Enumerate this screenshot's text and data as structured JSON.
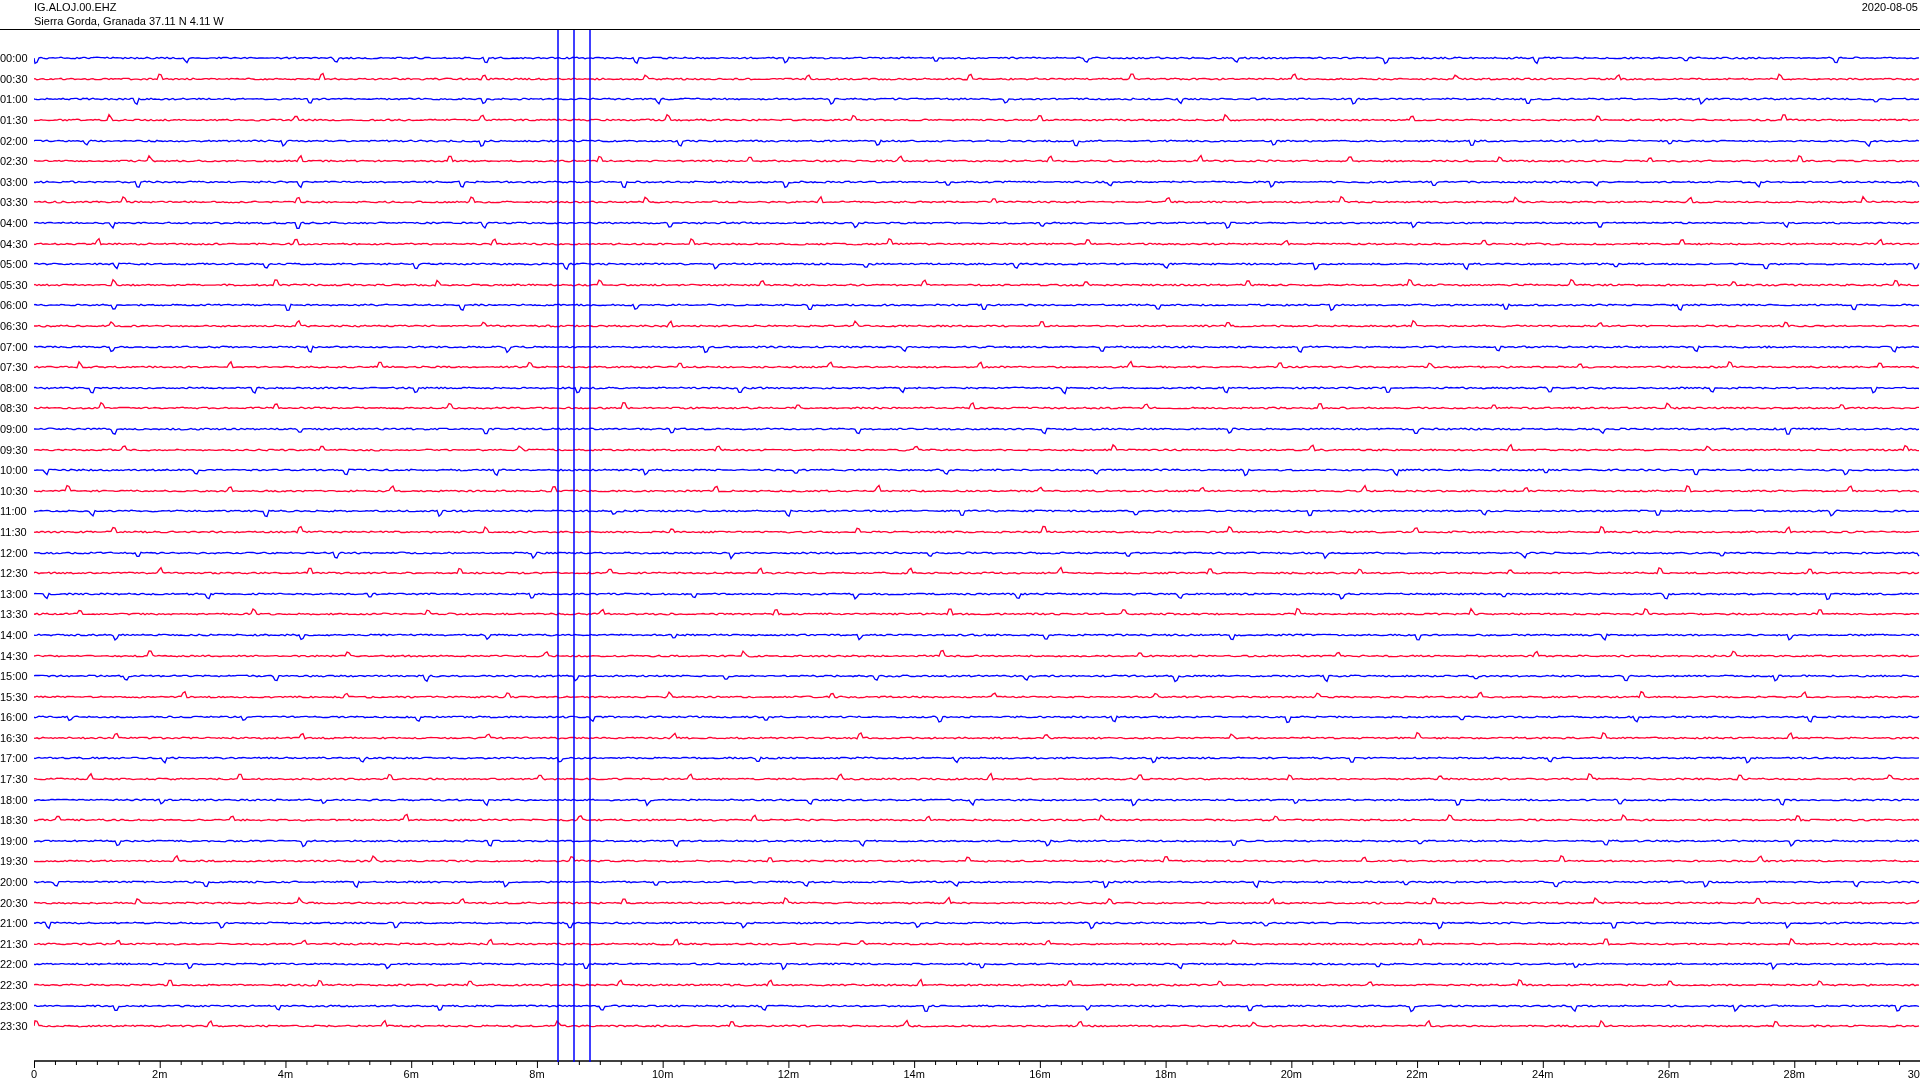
{
  "header": {
    "station": "IG.ALOJ.00.EHZ",
    "location": "Sierra Gorda, Granada  37.11 N 4.11 W",
    "date": "2020-08-05"
  },
  "rows": [
    {
      "time": "00:00",
      "color": "#0000ff"
    },
    {
      "time": "00:30",
      "color": "#ff0033"
    },
    {
      "time": "01:00",
      "color": "#0000ff"
    },
    {
      "time": "01:30",
      "color": "#ff0033"
    },
    {
      "time": "02:00",
      "color": "#0000ff"
    },
    {
      "time": "02:30",
      "color": "#ff0033"
    },
    {
      "time": "03:00",
      "color": "#0000ff"
    },
    {
      "time": "03:30",
      "color": "#ff0033"
    },
    {
      "time": "04:00",
      "color": "#0000ff"
    },
    {
      "time": "04:30",
      "color": "#ff0033"
    },
    {
      "time": "05:00",
      "color": "#0000ff"
    },
    {
      "time": "05:30",
      "color": "#ff0033"
    },
    {
      "time": "06:00",
      "color": "#0000ff"
    },
    {
      "time": "06:30",
      "color": "#ff0033"
    },
    {
      "time": "07:00",
      "color": "#0000ff"
    },
    {
      "time": "07:30",
      "color": "#ff0033"
    },
    {
      "time": "08:00",
      "color": "#0000ff"
    },
    {
      "time": "08:30",
      "color": "#ff0033"
    },
    {
      "time": "09:00",
      "color": "#0000ff"
    },
    {
      "time": "09:30",
      "color": "#ff0033"
    },
    {
      "time": "10:00",
      "color": "#0000ff"
    },
    {
      "time": "10:30",
      "color": "#ff0033"
    },
    {
      "time": "11:00",
      "color": "#0000ff"
    },
    {
      "time": "11:30",
      "color": "#ff0033"
    },
    {
      "time": "12:00",
      "color": "#0000ff"
    },
    {
      "time": "12:30",
      "color": "#ff0033"
    },
    {
      "time": "13:00",
      "color": "#0000ff"
    },
    {
      "time": "13:30",
      "color": "#ff0033"
    },
    {
      "time": "14:00",
      "color": "#0000ff"
    },
    {
      "time": "14:30",
      "color": "#ff0033"
    },
    {
      "time": "15:00",
      "color": "#0000ff"
    },
    {
      "time": "15:30",
      "color": "#ff0033"
    },
    {
      "time": "16:00",
      "color": "#0000ff"
    },
    {
      "time": "16:30",
      "color": "#ff0033"
    },
    {
      "time": "17:00",
      "color": "#0000ff"
    },
    {
      "time": "17:30",
      "color": "#ff0033"
    },
    {
      "time": "18:00",
      "color": "#0000ff"
    },
    {
      "time": "18:30",
      "color": "#ff0033"
    },
    {
      "time": "19:00",
      "color": "#0000ff"
    },
    {
      "time": "19:30",
      "color": "#ff0033"
    },
    {
      "time": "20:00",
      "color": "#0000ff"
    },
    {
      "time": "20:30",
      "color": "#ff0033"
    },
    {
      "time": "21:00",
      "color": "#0000ff"
    },
    {
      "time": "21:30",
      "color": "#ff0033"
    },
    {
      "time": "22:00",
      "color": "#0000ff"
    },
    {
      "time": "22:30",
      "color": "#ff0033"
    },
    {
      "time": "23:00",
      "color": "#0000ff"
    },
    {
      "time": "23:30",
      "color": "#ff0033"
    }
  ],
  "axis_labels": [
    "0",
    "2m",
    "4m",
    "6m",
    "8m",
    "10m",
    "12m",
    "14m",
    "16m",
    "18m",
    "20m",
    "22m",
    "24m",
    "26m",
    "28m",
    "30"
  ]
}
